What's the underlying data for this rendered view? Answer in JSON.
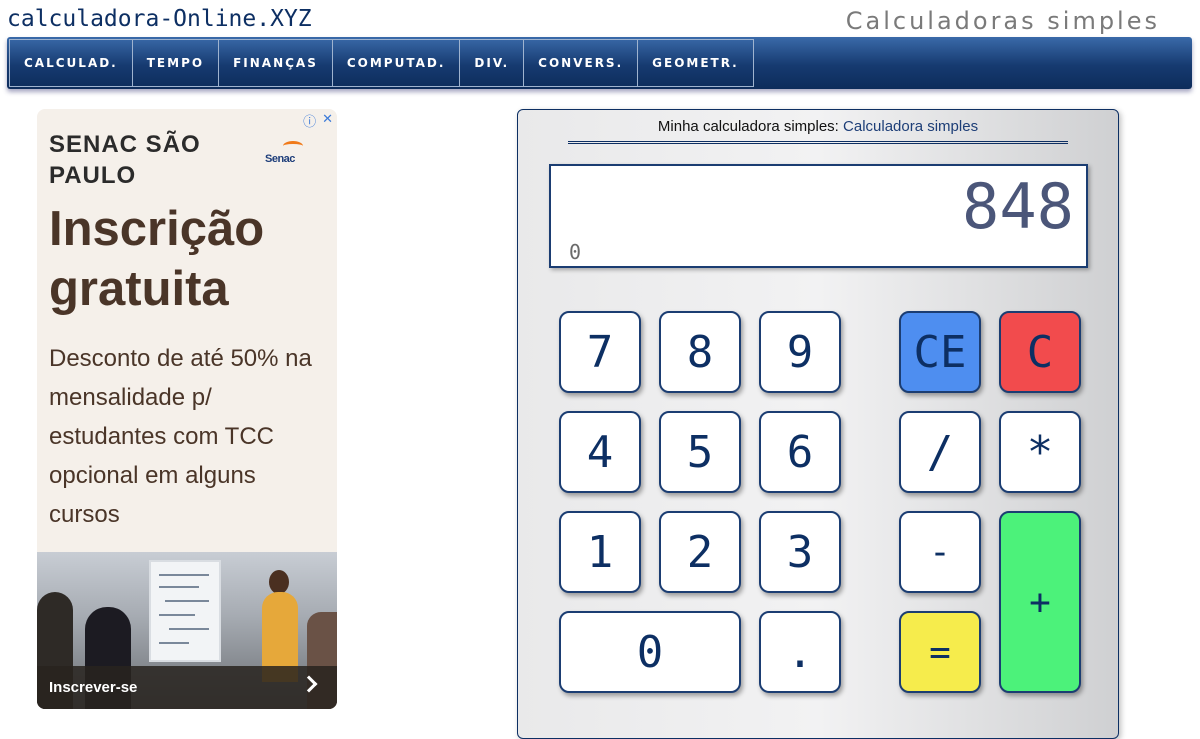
{
  "header": {
    "site_title": "calculadora-Online.XYZ",
    "tagline": "Calculadoras simples"
  },
  "nav": {
    "items": [
      "CALCULAD.",
      "TEMPO",
      "FINANÇAS",
      "COMPUTAD.",
      "DIV.",
      "CONVERS.",
      "GEOMETR."
    ]
  },
  "ad": {
    "brand": "SENAC SÃO PAULO",
    "logo_text": "Senac",
    "headline": "Inscrição gratuita",
    "body": "Desconto de até 50% na mensalidade p/ estudantes com TCC opcional em alguns cursos",
    "cta": "Inscrever-se",
    "choices_icon": "info-icon",
    "close_icon": "close-icon"
  },
  "calculator": {
    "header_prefix": "Minha calculadora simples: ",
    "header_link": "Calculadora simples",
    "display_value": "848",
    "memory_value": "0",
    "keys": {
      "k7": "7",
      "k8": "8",
      "k9": "9",
      "k4": "4",
      "k5": "5",
      "k6": "6",
      "k1": "1",
      "k2": "2",
      "k3": "3",
      "k0": "0",
      "dot": ".",
      "ce": "CE",
      "clear": "C",
      "divide": "/",
      "multiply": "*",
      "minus": "-",
      "plus": "+",
      "equals": "="
    },
    "colors": {
      "ce": "#4e8ef0",
      "clear": "#f24b4d",
      "equals": "#f6ec4c",
      "plus": "#4cf27a",
      "key_text": "#0d2f63"
    }
  }
}
